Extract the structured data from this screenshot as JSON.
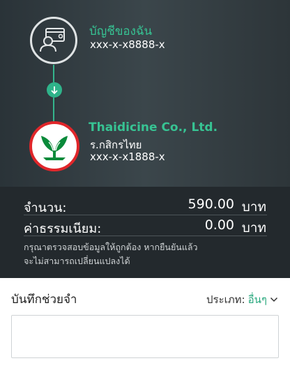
{
  "from_account": {
    "name": "บัญชีของฉัน",
    "number": "xxx-x-x8888-x",
    "icon": "account-card-user-icon"
  },
  "to_account": {
    "name": "Thaidicine Co., Ltd.",
    "bank": "ร.กสิกรไทย",
    "number": "xxx-x-x1888-x",
    "icon": "kasikorn-bank-logo"
  },
  "transfer_arrow_icon": "arrow-down-icon",
  "summary": {
    "amount_label": "จำนวน:",
    "amount_value": "590.00",
    "amount_unit": "บาท",
    "fee_label": "ค่าธรรมเนียม:",
    "fee_value": "0.00",
    "fee_unit": "บาท",
    "note_line1": "กรุณาตรวจสอบข้อมูลให้ถูกต้อง หากยืนยันแล้ว",
    "note_line2": "จะไม่สามารถเปลี่ยนแปลงได้"
  },
  "memo": {
    "label": "บันทึกช่วยจำ",
    "type_label": "ประเภท:",
    "type_value": "อื่นๆ",
    "input_value": ""
  },
  "colors": {
    "accent_green": "#37c393",
    "bank_red": "#e0262a",
    "bank_green": "#0a8a3a"
  }
}
